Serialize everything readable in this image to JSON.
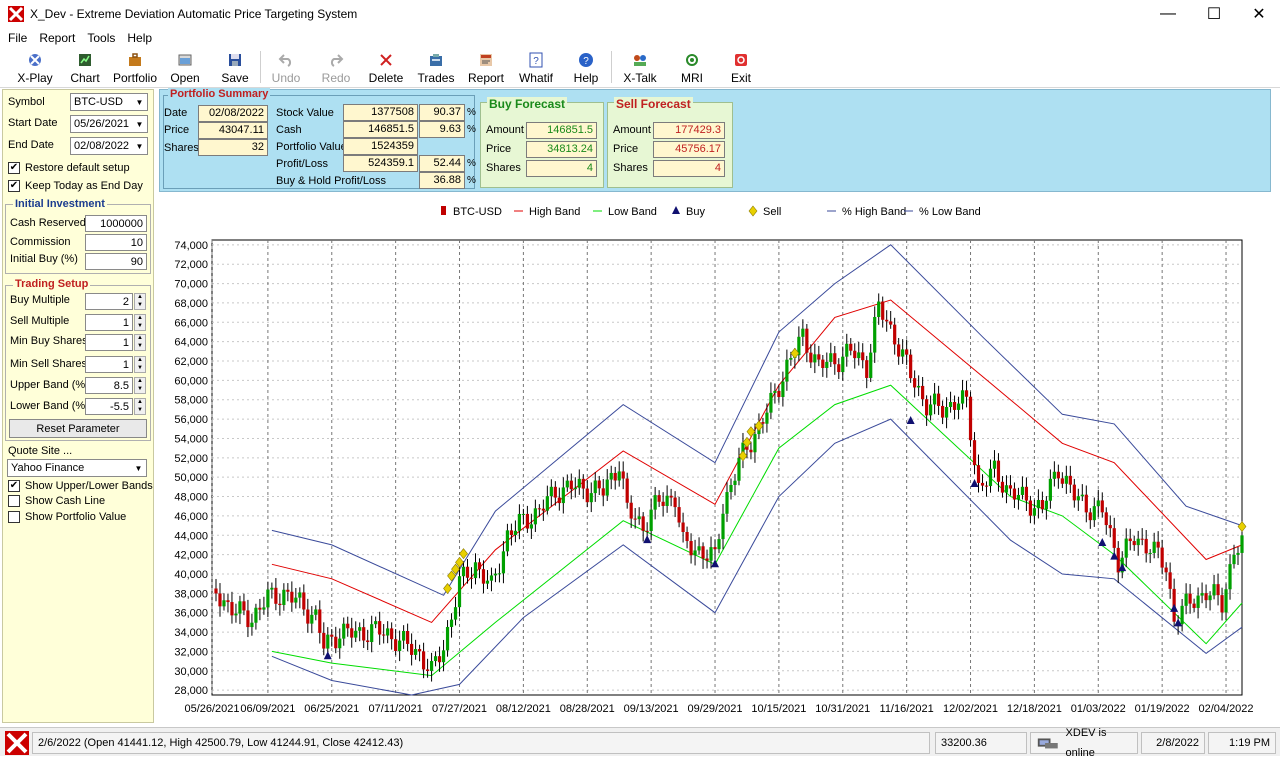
{
  "window": {
    "title": "X_Dev - Extreme Deviation Automatic Price Targeting System",
    "minimize": "—",
    "maximize": "☐",
    "close": "✕"
  },
  "menu": [
    "File",
    "Report",
    "Tools",
    "Help"
  ],
  "toolbar": [
    {
      "label": "X-Play",
      "icon": "x-play-icon",
      "enabled": true
    },
    {
      "label": "Chart",
      "icon": "chart-icon",
      "enabled": true
    },
    {
      "label": "Portfolio",
      "icon": "portfolio-icon",
      "enabled": true
    },
    {
      "label": "Open",
      "icon": "open-icon",
      "enabled": true
    },
    {
      "label": "Save",
      "icon": "save-icon",
      "enabled": true
    },
    {
      "label": "Undo",
      "icon": "undo-icon",
      "enabled": false
    },
    {
      "label": "Redo",
      "icon": "redo-icon",
      "enabled": false
    },
    {
      "label": "Delete",
      "icon": "delete-icon",
      "enabled": true
    },
    {
      "label": "Trades",
      "icon": "trades-icon",
      "enabled": true
    },
    {
      "label": "Report",
      "icon": "report-icon",
      "enabled": true
    },
    {
      "label": "Whatif",
      "icon": "whatif-icon",
      "enabled": true
    },
    {
      "label": "Help",
      "icon": "help-icon",
      "enabled": true
    },
    {
      "label": "X-Talk",
      "icon": "x-talk-icon",
      "enabled": true
    },
    {
      "label": "MRI",
      "icon": "mri-icon",
      "enabled": true
    },
    {
      "label": "Exit",
      "icon": "exit-icon",
      "enabled": true
    }
  ],
  "left": {
    "symbol_label": "Symbol",
    "symbol_value": "BTC-USD",
    "start_label": "Start Date",
    "start_value": "05/26/2021",
    "end_label": "End Date",
    "end_value": "02/08/2022",
    "restore_label": "Restore default setup",
    "restore_checked": true,
    "keep_label": "Keep Today as End Day",
    "keep_checked": true,
    "initial_title": "Initial Investment",
    "cash_label": "Cash Reserved",
    "cash_value": "1000000",
    "commission_label": "Commission",
    "commission_value": "10",
    "initbuy_label": "Initial Buy (%)",
    "initbuy_value": "90",
    "trading_title": "Trading Setup",
    "buymult_label": "Buy Multiple",
    "buymult_value": "2",
    "sellmult_label": "Sell Multiple",
    "sellmult_value": "1",
    "minbuy_label": "Min Buy Shares",
    "minbuy_value": "1",
    "minsell_label": "Min Sell Shares",
    "minsell_value": "1",
    "upper_label": "Upper Band (%)",
    "upper_value": "8.5",
    "lower_label": "Lower Band (%)",
    "lower_value": "-5.5",
    "reset_label": "Reset Parameter",
    "quote_label": "Quote Site ...",
    "quote_value": "Yahoo Finance",
    "show_bands_label": "Show Upper/Lower Bands",
    "show_bands_checked": true,
    "show_cash_label": "Show Cash Line",
    "show_cash_checked": false,
    "show_portfolio_label": "Show Portfolio Value",
    "show_portfolio_checked": false
  },
  "summary": {
    "title": "Portfolio Summary",
    "date_label": "Date",
    "date_value": "02/08/2022",
    "price_label": "Price",
    "price_value": "43047.11",
    "shares_label": "Shares",
    "shares_value": "32",
    "stock_label": "Stock Value",
    "stock_value": "1377508",
    "stock_pct": "90.37",
    "cash_label": "Cash",
    "cash_value": "146851.5",
    "cash_pct": "9.63",
    "pv_label": "Portfolio Value",
    "pv_value": "1524359",
    "pl_label": "Profit/Loss",
    "pl_value": "524359.1",
    "pl_pct": "52.44",
    "bh_label": "Buy & Hold Profit/Loss",
    "bh_pct": "36.88",
    "pct_sign": "%",
    "buy_title": "Buy Forecast",
    "buy_amount": "146851.5",
    "buy_price": "34813.24",
    "buy_shares": "4",
    "sell_title": "Sell Forecast",
    "sell_amount": "177429.3",
    "sell_price": "45756.17",
    "sell_shares": "4",
    "amount_label": "Amount",
    "fprice_label": "Price",
    "fshares_label": "Shares"
  },
  "chart_data": {
    "type": "line",
    "legend": [
      "BTC-USD",
      "High Band",
      "Low Band",
      "Buy",
      "Sell",
      "% High Band",
      "% Low Band"
    ],
    "legend_placement": "top",
    "grid": true,
    "colors": {
      "candle_up": "#00a000",
      "candle_down": "#c00000",
      "high_band": "#e00000",
      "low_band": "#00dd00",
      "pct_band": "#3a4a9a",
      "buy": "#101070",
      "sell": "#e8d000"
    },
    "y_ticks": [
      "74,000",
      "72,000",
      "70,000",
      "68,000",
      "66,000",
      "64,000",
      "62,000",
      "60,000",
      "58,000",
      "56,000",
      "54,000",
      "52,000",
      "50,000",
      "48,000",
      "46,000",
      "44,000",
      "42,000",
      "40,000",
      "38,000",
      "36,000",
      "34,000",
      "32,000",
      "30,000",
      "28,000"
    ],
    "ylim": [
      27500,
      74500
    ],
    "x_ticks": [
      "05/26/2021",
      "06/09/2021",
      "06/25/2021",
      "07/11/2021",
      "07/27/2021",
      "08/12/2021",
      "08/28/2021",
      "09/13/2021",
      "09/29/2021",
      "10/15/2021",
      "10/31/2021",
      "11/16/2021",
      "12/02/2021",
      "12/18/2021",
      "01/03/2022",
      "01/19/2022",
      "02/04/2022"
    ],
    "xlim": [
      "05/26/2021",
      "02/08/2022"
    ],
    "price_series": [
      [
        "05/26/2021",
        38500
      ],
      [
        "06/01/2021",
        36000
      ],
      [
        "06/05/2021",
        35500
      ],
      [
        "06/09/2021",
        37500
      ],
      [
        "06/13/2021",
        38000
      ],
      [
        "06/17/2021",
        37000
      ],
      [
        "06/21/2021",
        35500
      ],
      [
        "06/23/2021",
        32500
      ],
      [
        "06/27/2021",
        34000
      ],
      [
        "07/01/2021",
        33800
      ],
      [
        "07/05/2021",
        34200
      ],
      [
        "07/09/2021",
        33800
      ],
      [
        "07/13/2021",
        32800
      ],
      [
        "07/17/2021",
        31800
      ],
      [
        "07/20/2021",
        29800
      ],
      [
        "07/23/2021",
        32500
      ],
      [
        "07/27/2021",
        39000
      ],
      [
        "07/31/2021",
        41000
      ],
      [
        "08/04/2021",
        38500
      ],
      [
        "08/08/2021",
        44000
      ],
      [
        "08/12/2021",
        45500
      ],
      [
        "08/16/2021",
        46500
      ],
      [
        "08/20/2021",
        48500
      ],
      [
        "08/24/2021",
        49000
      ],
      [
        "08/28/2021",
        48800
      ],
      [
        "09/01/2021",
        48500
      ],
      [
        "09/05/2021",
        51500
      ],
      [
        "09/07/2021",
        46500
      ],
      [
        "09/11/2021",
        45000
      ],
      [
        "09/15/2021",
        47500
      ],
      [
        "09/19/2021",
        48000
      ],
      [
        "09/21/2021",
        43000
      ],
      [
        "09/25/2021",
        42500
      ],
      [
        "09/29/2021",
        41500
      ],
      [
        "10/01/2021",
        47000
      ],
      [
        "10/05/2021",
        51500
      ],
      [
        "10/09/2021",
        54500
      ],
      [
        "10/13/2021",
        57500
      ],
      [
        "10/17/2021",
        61500
      ],
      [
        "10/21/2021",
        64500
      ],
      [
        "10/25/2021",
        61500
      ],
      [
        "10/29/2021",
        62000
      ],
      [
        "11/02/2021",
        63000
      ],
      [
        "11/06/2021",
        61500
      ],
      [
        "11/09/2021",
        67500
      ],
      [
        "11/13/2021",
        64500
      ],
      [
        "11/17/2021",
        60500
      ],
      [
        "11/21/2021",
        57500
      ],
      [
        "11/25/2021",
        57000
      ],
      [
        "11/29/2021",
        58000
      ],
      [
        "12/01/2021",
        57500
      ],
      [
        "12/04/2021",
        49000
      ],
      [
        "12/08/2021",
        50500
      ],
      [
        "12/12/2021",
        48500
      ],
      [
        "12/16/2021",
        47500
      ],
      [
        "12/20/2021",
        46800
      ],
      [
        "12/24/2021",
        51000
      ],
      [
        "12/28/2021",
        48000
      ],
      [
        "12/31/2021",
        47000
      ],
      [
        "01/04/2022",
        46500
      ],
      [
        "01/08/2022",
        41500
      ],
      [
        "01/12/2022",
        43500
      ],
      [
        "01/16/2022",
        43000
      ],
      [
        "01/20/2022",
        40500
      ],
      [
        "01/22/2022",
        35500
      ],
      [
        "01/26/2022",
        37000
      ],
      [
        "01/30/2022",
        38200
      ],
      [
        "02/03/2022",
        37000
      ],
      [
        "02/06/2022",
        42400
      ],
      [
        "02/08/2022",
        43000
      ]
    ],
    "high_band": [
      [
        "06/10/2021",
        41000
      ],
      [
        "06/25/2021",
        39500
      ],
      [
        "07/20/2021",
        35000
      ],
      [
        "08/05/2021",
        42500
      ],
      [
        "09/06/2021",
        52700
      ],
      [
        "09/29/2021",
        47200
      ],
      [
        "10/15/2021",
        59500
      ],
      [
        "10/29/2021",
        66500
      ],
      [
        "11/12/2021",
        68300
      ],
      [
        "12/12/2021",
        58000
      ],
      [
        "12/25/2021",
        53500
      ],
      [
        "01/07/2022",
        51500
      ],
      [
        "01/30/2022",
        41500
      ],
      [
        "02/08/2022",
        43000
      ]
    ],
    "low_band": [
      [
        "06/10/2021",
        32000
      ],
      [
        "06/25/2021",
        30800
      ],
      [
        "07/20/2021",
        29500
      ],
      [
        "08/05/2021",
        35000
      ],
      [
        "09/06/2021",
        45500
      ],
      [
        "09/29/2021",
        41000
      ],
      [
        "10/15/2021",
        53000
      ],
      [
        "10/29/2021",
        57500
      ],
      [
        "11/12/2021",
        59500
      ],
      [
        "12/12/2021",
        48000
      ],
      [
        "12/25/2021",
        46000
      ],
      [
        "01/07/2022",
        42000
      ],
      [
        "01/30/2022",
        32800
      ],
      [
        "02/08/2022",
        37000
      ]
    ],
    "pct_high_band": [
      [
        "06/10/2021",
        44500
      ],
      [
        "06/25/2021",
        43000
      ],
      [
        "07/23/2021",
        37800
      ],
      [
        "08/05/2021",
        46500
      ],
      [
        "09/06/2021",
        57500
      ],
      [
        "09/29/2021",
        51500
      ],
      [
        "10/15/2021",
        65000
      ],
      [
        "10/29/2021",
        70000
      ],
      [
        "11/12/2021",
        74000
      ],
      [
        "12/05/2021",
        64500
      ],
      [
        "12/25/2021",
        56500
      ],
      [
        "01/07/2022",
        55500
      ],
      [
        "01/25/2022",
        47000
      ],
      [
        "02/08/2022",
        45000
      ]
    ],
    "pct_low_band": [
      [
        "06/10/2021",
        31500
      ],
      [
        "06/25/2021",
        29000
      ],
      [
        "07/15/2021",
        27500
      ],
      [
        "07/27/2021",
        28600
      ],
      [
        "08/12/2021",
        35500
      ],
      [
        "09/06/2021",
        43000
      ],
      [
        "09/29/2021",
        36000
      ],
      [
        "10/15/2021",
        48000
      ],
      [
        "10/29/2021",
        53500
      ],
      [
        "11/12/2021",
        56000
      ],
      [
        "12/12/2021",
        43500
      ],
      [
        "12/25/2021",
        40000
      ],
      [
        "01/07/2022",
        39500
      ],
      [
        "01/30/2022",
        31800
      ],
      [
        "02/08/2022",
        34500
      ]
    ],
    "buy_points": [
      [
        "06/24/2021",
        31500
      ],
      [
        "09/12/2021",
        43500
      ],
      [
        "09/29/2021",
        41000
      ],
      [
        "11/17/2021",
        55800
      ],
      [
        "12/03/2021",
        49300
      ],
      [
        "01/04/2022",
        43200
      ],
      [
        "01/07/2022",
        41800
      ],
      [
        "01/09/2022",
        40600
      ],
      [
        "01/22/2022",
        36400
      ],
      [
        "01/23/2022",
        34900
      ]
    ],
    "sell_points": [
      [
        "07/24/2021",
        38500
      ],
      [
        "07/25/2021",
        39800
      ],
      [
        "07/26/2021",
        40500
      ],
      [
        "07/27/2021",
        41200
      ],
      [
        "07/28/2021",
        42100
      ],
      [
        "10/06/2021",
        52200
      ],
      [
        "10/07/2021",
        53600
      ],
      [
        "10/08/2021",
        54700
      ],
      [
        "10/10/2021",
        55300
      ],
      [
        "10/19/2021",
        62800
      ],
      [
        "02/08/2022",
        44900
      ]
    ]
  },
  "status": {
    "info": "2/6/2022 (Open 41441.12, High 42500.79, Low 41244.91, Close 42412.43)",
    "value": "33200.36",
    "online": "XDEV is online",
    "date": "2/8/2022",
    "time": "1:19 PM"
  }
}
